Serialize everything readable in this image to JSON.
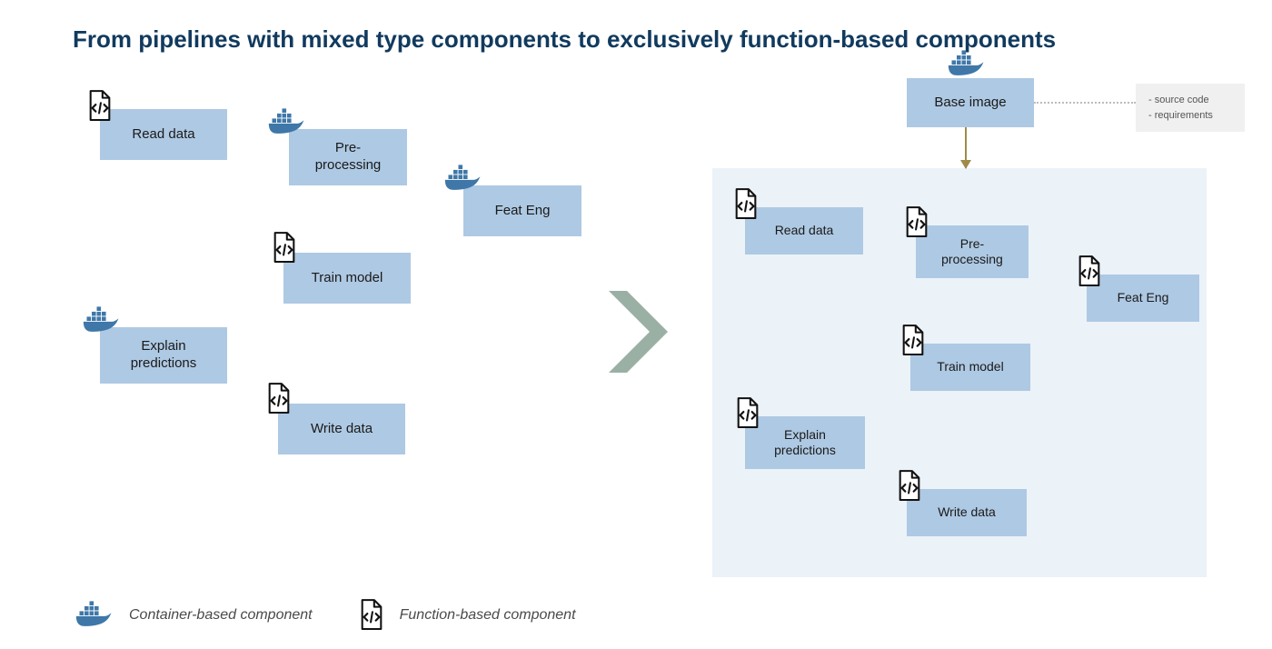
{
  "title": "From pipelines with mixed type components to exclusively function-based components",
  "left": {
    "read_data": "Read data",
    "preprocessing": "Pre-\nprocessing",
    "feat_eng": "Feat Eng",
    "train_model": "Train model",
    "explain": "Explain\npredictions",
    "write_data": "Write data"
  },
  "right": {
    "base_image": "Base image",
    "read_data": "Read data",
    "preprocessing": "Pre-\nprocessing",
    "feat_eng": "Feat Eng",
    "train_model": "Train model",
    "explain": "Explain\npredictions",
    "write_data": "Write data"
  },
  "info": {
    "line1": "- source code",
    "line2": "- requirements"
  },
  "legend": {
    "container": "Container-based component",
    "function": "Function-based component"
  },
  "icons": {
    "docker": "docker-icon",
    "code_file": "code-file-icon"
  }
}
